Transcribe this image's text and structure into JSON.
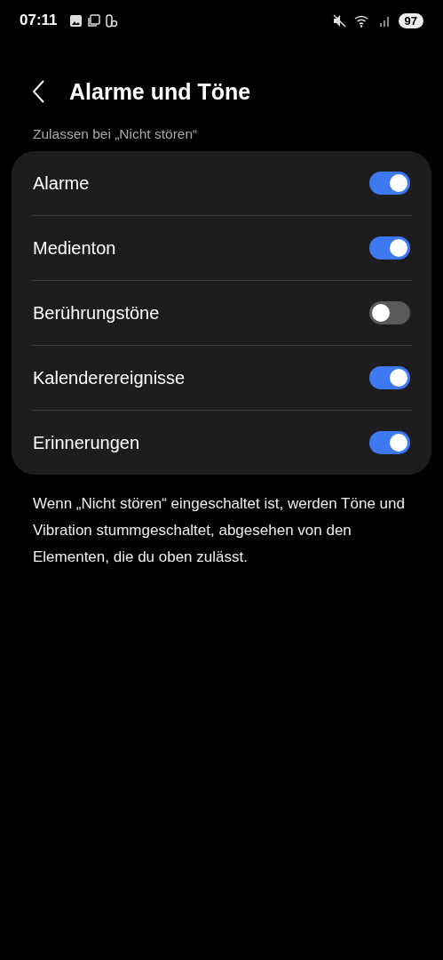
{
  "status_bar": {
    "time": "07:11",
    "battery": "97"
  },
  "header": {
    "title": "Alarme und Töne"
  },
  "section": {
    "label": "Zulassen bei „Nicht stören“"
  },
  "settings": [
    {
      "label": "Alarme",
      "on": true
    },
    {
      "label": "Medienton",
      "on": true
    },
    {
      "label": "Berührungstöne",
      "on": false
    },
    {
      "label": "Kalenderereignisse",
      "on": true
    },
    {
      "label": "Erinnerungen",
      "on": true
    }
  ],
  "footer": {
    "text": "Wenn „Nicht stören“ eingeschaltet ist, werden Töne und Vibration stummgeschaltet, abgesehen von den Elementen, die du oben zulässt."
  }
}
